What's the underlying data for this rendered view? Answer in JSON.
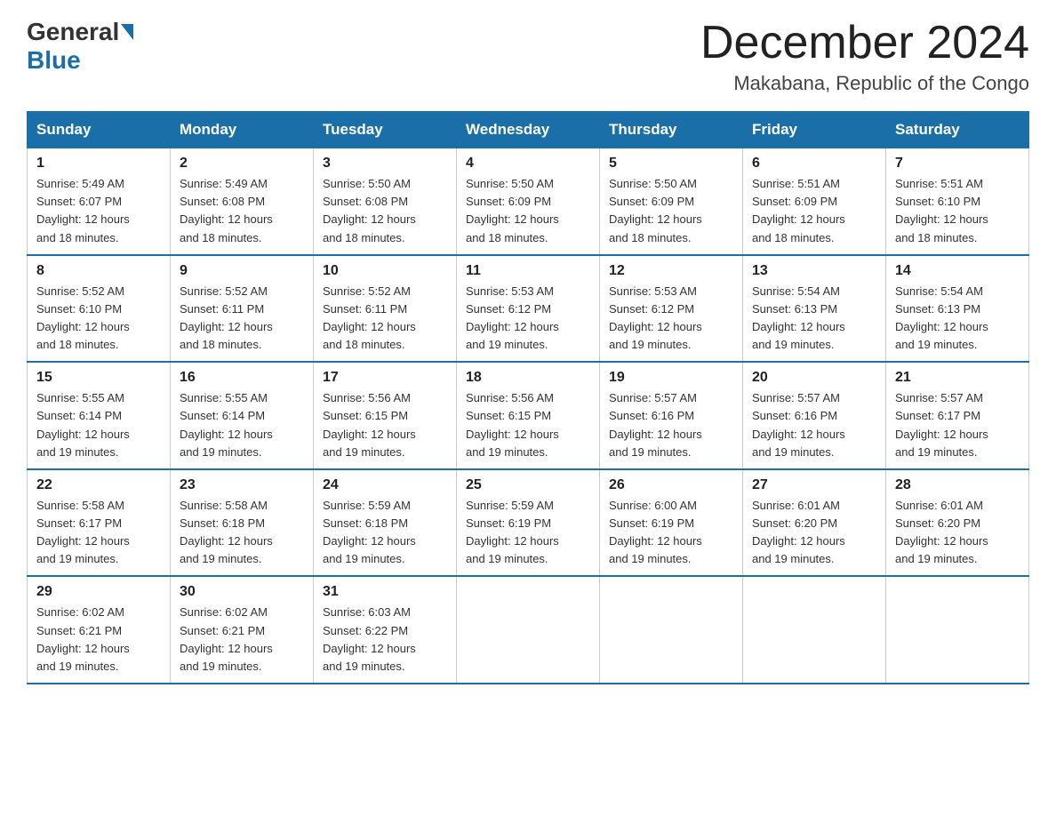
{
  "header": {
    "logo_general": "General",
    "logo_blue": "Blue",
    "month_title": "December 2024",
    "subtitle": "Makabana, Republic of the Congo"
  },
  "days_of_week": [
    "Sunday",
    "Monday",
    "Tuesday",
    "Wednesday",
    "Thursday",
    "Friday",
    "Saturday"
  ],
  "weeks": [
    [
      {
        "day": "1",
        "sunrise": "5:49 AM",
        "sunset": "6:07 PM",
        "daylight": "12 hours and 18 minutes."
      },
      {
        "day": "2",
        "sunrise": "5:49 AM",
        "sunset": "6:08 PM",
        "daylight": "12 hours and 18 minutes."
      },
      {
        "day": "3",
        "sunrise": "5:50 AM",
        "sunset": "6:08 PM",
        "daylight": "12 hours and 18 minutes."
      },
      {
        "day": "4",
        "sunrise": "5:50 AM",
        "sunset": "6:09 PM",
        "daylight": "12 hours and 18 minutes."
      },
      {
        "day": "5",
        "sunrise": "5:50 AM",
        "sunset": "6:09 PM",
        "daylight": "12 hours and 18 minutes."
      },
      {
        "day": "6",
        "sunrise": "5:51 AM",
        "sunset": "6:09 PM",
        "daylight": "12 hours and 18 minutes."
      },
      {
        "day": "7",
        "sunrise": "5:51 AM",
        "sunset": "6:10 PM",
        "daylight": "12 hours and 18 minutes."
      }
    ],
    [
      {
        "day": "8",
        "sunrise": "5:52 AM",
        "sunset": "6:10 PM",
        "daylight": "12 hours and 18 minutes."
      },
      {
        "day": "9",
        "sunrise": "5:52 AM",
        "sunset": "6:11 PM",
        "daylight": "12 hours and 18 minutes."
      },
      {
        "day": "10",
        "sunrise": "5:52 AM",
        "sunset": "6:11 PM",
        "daylight": "12 hours and 18 minutes."
      },
      {
        "day": "11",
        "sunrise": "5:53 AM",
        "sunset": "6:12 PM",
        "daylight": "12 hours and 19 minutes."
      },
      {
        "day": "12",
        "sunrise": "5:53 AM",
        "sunset": "6:12 PM",
        "daylight": "12 hours and 19 minutes."
      },
      {
        "day": "13",
        "sunrise": "5:54 AM",
        "sunset": "6:13 PM",
        "daylight": "12 hours and 19 minutes."
      },
      {
        "day": "14",
        "sunrise": "5:54 AM",
        "sunset": "6:13 PM",
        "daylight": "12 hours and 19 minutes."
      }
    ],
    [
      {
        "day": "15",
        "sunrise": "5:55 AM",
        "sunset": "6:14 PM",
        "daylight": "12 hours and 19 minutes."
      },
      {
        "day": "16",
        "sunrise": "5:55 AM",
        "sunset": "6:14 PM",
        "daylight": "12 hours and 19 minutes."
      },
      {
        "day": "17",
        "sunrise": "5:56 AM",
        "sunset": "6:15 PM",
        "daylight": "12 hours and 19 minutes."
      },
      {
        "day": "18",
        "sunrise": "5:56 AM",
        "sunset": "6:15 PM",
        "daylight": "12 hours and 19 minutes."
      },
      {
        "day": "19",
        "sunrise": "5:57 AM",
        "sunset": "6:16 PM",
        "daylight": "12 hours and 19 minutes."
      },
      {
        "day": "20",
        "sunrise": "5:57 AM",
        "sunset": "6:16 PM",
        "daylight": "12 hours and 19 minutes."
      },
      {
        "day": "21",
        "sunrise": "5:57 AM",
        "sunset": "6:17 PM",
        "daylight": "12 hours and 19 minutes."
      }
    ],
    [
      {
        "day": "22",
        "sunrise": "5:58 AM",
        "sunset": "6:17 PM",
        "daylight": "12 hours and 19 minutes."
      },
      {
        "day": "23",
        "sunrise": "5:58 AM",
        "sunset": "6:18 PM",
        "daylight": "12 hours and 19 minutes."
      },
      {
        "day": "24",
        "sunrise": "5:59 AM",
        "sunset": "6:18 PM",
        "daylight": "12 hours and 19 minutes."
      },
      {
        "day": "25",
        "sunrise": "5:59 AM",
        "sunset": "6:19 PM",
        "daylight": "12 hours and 19 minutes."
      },
      {
        "day": "26",
        "sunrise": "6:00 AM",
        "sunset": "6:19 PM",
        "daylight": "12 hours and 19 minutes."
      },
      {
        "day": "27",
        "sunrise": "6:01 AM",
        "sunset": "6:20 PM",
        "daylight": "12 hours and 19 minutes."
      },
      {
        "day": "28",
        "sunrise": "6:01 AM",
        "sunset": "6:20 PM",
        "daylight": "12 hours and 19 minutes."
      }
    ],
    [
      {
        "day": "29",
        "sunrise": "6:02 AM",
        "sunset": "6:21 PM",
        "daylight": "12 hours and 19 minutes."
      },
      {
        "day": "30",
        "sunrise": "6:02 AM",
        "sunset": "6:21 PM",
        "daylight": "12 hours and 19 minutes."
      },
      {
        "day": "31",
        "sunrise": "6:03 AM",
        "sunset": "6:22 PM",
        "daylight": "12 hours and 19 minutes."
      },
      null,
      null,
      null,
      null
    ]
  ]
}
